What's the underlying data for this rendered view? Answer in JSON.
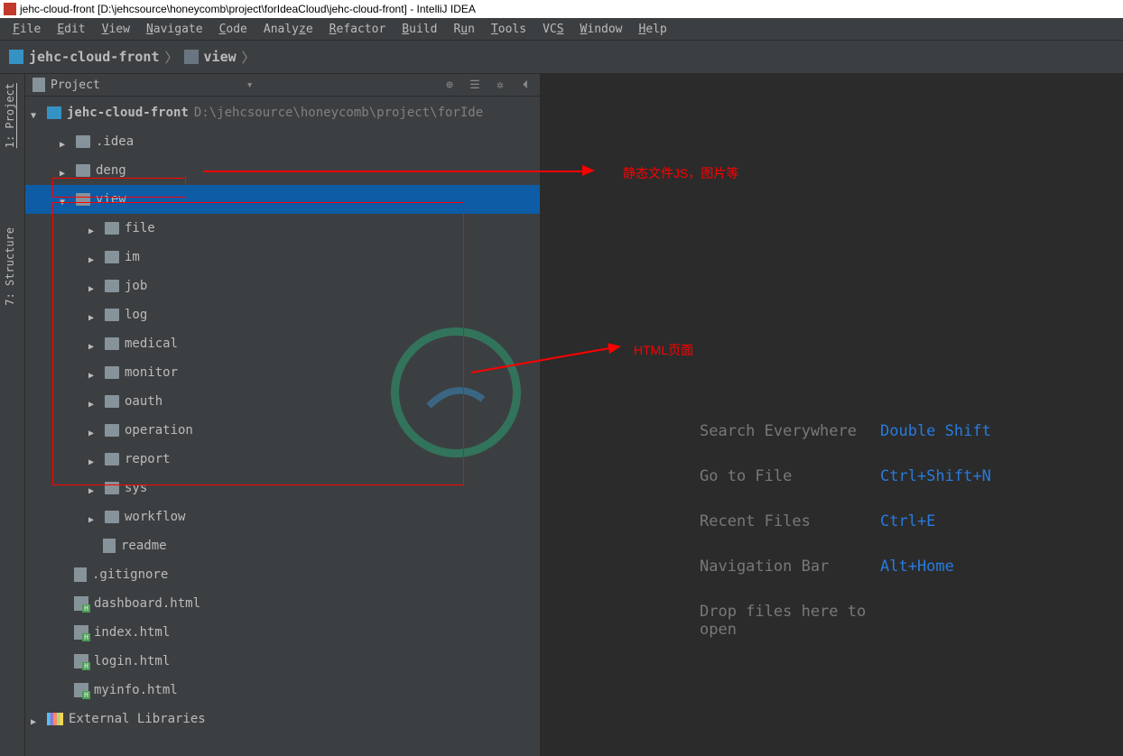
{
  "titlebar": {
    "text": "jehc-cloud-front [D:\\jehcsource\\honeycomb\\project\\forIdeaCloud\\jehc-cloud-front] - IntelliJ IDEA"
  },
  "menubar": {
    "items": [
      "File",
      "Edit",
      "View",
      "Navigate",
      "Code",
      "Analyze",
      "Refactor",
      "Build",
      "Run",
      "Tools",
      "VCS",
      "Window",
      "Help"
    ]
  },
  "breadcrumb": {
    "project": "jehc-cloud-front",
    "folder": "view"
  },
  "panel": {
    "title": "Project"
  },
  "tree": {
    "root_name": "jehc-cloud-front",
    "root_path": "D:\\jehcsource\\honeycomb\\project\\forIdeaCloud\\jehc-cloud-front",
    "idea": ".idea",
    "deng": "deng",
    "view": "view",
    "view_children": [
      "file",
      "im",
      "job",
      "log",
      "medical",
      "monitor",
      "oauth",
      "operation",
      "report"
    ],
    "sys": "sys",
    "workflow": "workflow",
    "readme": "readme",
    "gitignore": ".gitignore",
    "html_files": [
      "dashboard.html",
      "index.html",
      "login.html",
      "myinfo.html"
    ],
    "libraries": "External Libraries"
  },
  "vtabs": {
    "project": "1: Project",
    "structure": "7: Structure"
  },
  "welcome": {
    "rows": [
      {
        "label": "Search Everywhere",
        "key": "Double Shift"
      },
      {
        "label": "Go to File",
        "key": "Ctrl+Shift+N"
      },
      {
        "label": "Recent Files",
        "key": "Ctrl+E"
      },
      {
        "label": "Navigation Bar",
        "key": "Alt+Home"
      },
      {
        "label": "Drop files here to open",
        "key": ""
      }
    ]
  },
  "annotations": {
    "top": "静态文件JS，图片等",
    "mid": "HTML页面"
  }
}
